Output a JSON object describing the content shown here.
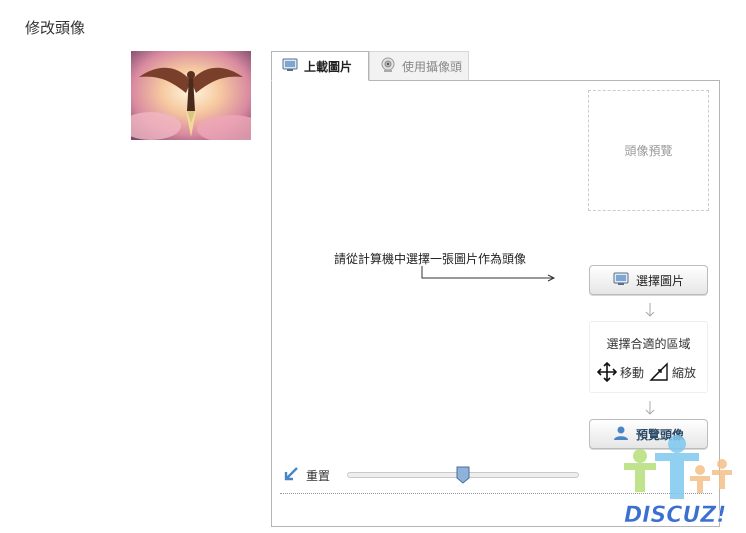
{
  "page": {
    "title": "修改頭像"
  },
  "tabs": [
    {
      "label": "上載圖片",
      "icon": "monitor-icon",
      "active": true
    },
    {
      "label": "使用攝像頭",
      "icon": "webcam-icon",
      "active": false
    }
  ],
  "preview": {
    "placeholder": "頭像預覽"
  },
  "instruction": "請從計算機中選擇一張圖片作為頭像",
  "buttons": {
    "select": "選擇圖片",
    "preview": "預覽頭像"
  },
  "steps": {
    "title": "選擇合適的區域",
    "move": "移動",
    "zoom": "縮放"
  },
  "controls": {
    "reset": "重置",
    "zoom_level": 0.5
  },
  "watermark": {
    "text": "DISCUZ!"
  },
  "colors": {
    "accent": "#4a86c5",
    "watermark": "#3b6fd0"
  }
}
